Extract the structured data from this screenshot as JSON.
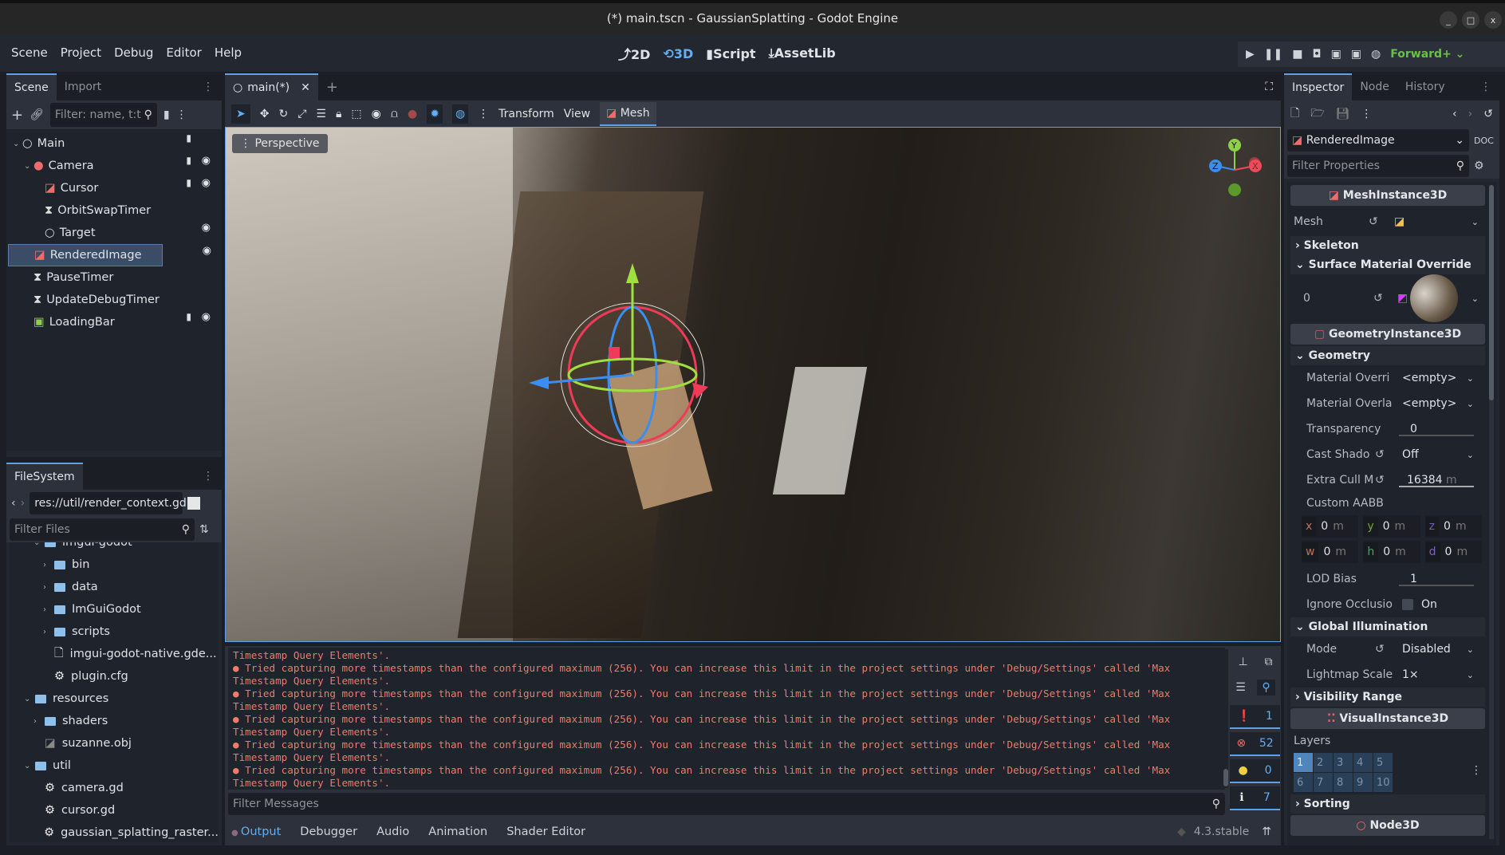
{
  "window": {
    "title": "(*) main.tscn - GaussianSplatting - Godot Engine",
    "min": "_",
    "max": "□",
    "close": "x"
  },
  "menu": [
    "Scene",
    "Project",
    "Debug",
    "Editor",
    "Help"
  ],
  "main_screens": [
    {
      "label": "2D",
      "icon": "⤴"
    },
    {
      "label": "3D",
      "icon": "⟲"
    },
    {
      "label": "Script",
      "icon": "▮"
    },
    {
      "label": "AssetLib",
      "icon": "⤓"
    }
  ],
  "run": {
    "renderer": "Forward+ ⌄"
  },
  "scene_dock": {
    "tabs": [
      "Scene",
      "Import"
    ],
    "filter_placeholder": "Filter: name, t:t",
    "tree": [
      {
        "label": "Main",
        "icon": "node3d-icon",
        "depth": 0,
        "script": true,
        "eye": false
      },
      {
        "label": "Camera",
        "icon": "camera-icon",
        "depth": 1,
        "script": true,
        "eye": true
      },
      {
        "label": "Cursor",
        "icon": "mesh-icon",
        "depth": 2,
        "script": true,
        "eye": true
      },
      {
        "label": "OrbitSwapTimer",
        "icon": "timer-icon",
        "depth": 2,
        "script": false,
        "eye": false
      },
      {
        "label": "Target",
        "icon": "node3d-icon",
        "depth": 2,
        "script": false,
        "eye": true
      },
      {
        "label": "RenderedImage",
        "icon": "mesh-icon",
        "depth": 1,
        "script": false,
        "eye": true,
        "selected": true
      },
      {
        "label": "PauseTimer",
        "icon": "timer-icon",
        "depth": 1,
        "script": false,
        "eye": false
      },
      {
        "label": "UpdateDebugTimer",
        "icon": "timer-icon",
        "depth": 1,
        "script": false,
        "eye": false
      },
      {
        "label": "LoadingBar",
        "icon": "texture-rect-icon",
        "depth": 1,
        "script": true,
        "eye": true
      }
    ]
  },
  "filesystem": {
    "tab": "FileSystem",
    "path": "res://util/render_context.gd",
    "filter_placeholder": "Filter Files",
    "items": [
      {
        "label": "imgui-godot",
        "type": "folder",
        "depth": 1,
        "open": true
      },
      {
        "label": "bin",
        "type": "folder",
        "depth": 2
      },
      {
        "label": "data",
        "type": "folder",
        "depth": 2
      },
      {
        "label": "ImGuiGodot",
        "type": "folder",
        "depth": 2
      },
      {
        "label": "scripts",
        "type": "folder",
        "depth": 2
      },
      {
        "label": "imgui-godot-native.gde...",
        "type": "file",
        "depth": 2
      },
      {
        "label": "plugin.cfg",
        "type": "cfg",
        "depth": 2
      },
      {
        "label": "resources",
        "type": "folder",
        "depth": 0,
        "open": true
      },
      {
        "label": "shaders",
        "type": "folder",
        "depth": 1
      },
      {
        "label": "suzanne.obj",
        "type": "mesh",
        "depth": 1
      },
      {
        "label": "util",
        "type": "folder",
        "depth": 0,
        "open": true
      },
      {
        "label": "camera.gd",
        "type": "script",
        "depth": 1
      },
      {
        "label": "cursor.gd",
        "type": "script",
        "depth": 1
      },
      {
        "label": "gaussian_splatting_raster...",
        "type": "script",
        "depth": 1
      }
    ]
  },
  "editor": {
    "scene_tab": "main(*)",
    "toolbar": {
      "transform": "Transform",
      "view": "View",
      "mesh": "Mesh"
    },
    "viewport_label": "Perspective",
    "gizmo_axes": [
      "X",
      "Y",
      "Z"
    ]
  },
  "output": {
    "lines": [
      {
        "text": "Timestamp Query Elements'.",
        "bullet": false
      },
      {
        "text": "Tried capturing more timestamps than the configured maximum (256). You can increase this limit in the project settings under 'Debug/Settings' called 'Max",
        "bullet": true
      },
      {
        "text": "Timestamp Query Elements'.",
        "bullet": false
      },
      {
        "text": "Tried capturing more timestamps than the configured maximum (256). You can increase this limit in the project settings under 'Debug/Settings' called 'Max",
        "bullet": true
      },
      {
        "text": "Timestamp Query Elements'.",
        "bullet": false
      },
      {
        "text": "Tried capturing more timestamps than the configured maximum (256). You can increase this limit in the project settings under 'Debug/Settings' called 'Max",
        "bullet": true
      },
      {
        "text": "Timestamp Query Elements'.",
        "bullet": false
      },
      {
        "text": "Tried capturing more timestamps than the configured maximum (256). You can increase this limit in the project settings under 'Debug/Settings' called 'Max",
        "bullet": true
      },
      {
        "text": "Timestamp Query Elements'.",
        "bullet": false
      },
      {
        "text": "Tried capturing more timestamps than the configured maximum (256). You can increase this limit in the project settings under 'Debug/Settings' called 'Max",
        "bullet": true
      },
      {
        "text": "Timestamp Query Elements'.",
        "bullet": false
      }
    ],
    "filter_placeholder": "Filter Messages",
    "counts": {
      "messages": "1",
      "errors": "52",
      "warnings": "0",
      "editor": "7"
    }
  },
  "bottom_tabs": [
    "Output",
    "Debugger",
    "Audio",
    "Animation",
    "Shader Editor"
  ],
  "version": "4.3.stable",
  "inspector": {
    "tabs": [
      "Inspector",
      "Node",
      "History"
    ],
    "node": "RenderedImage",
    "filter_placeholder": "Filter Properties",
    "mesh_instance": "MeshInstance3D",
    "mesh_label": "Mesh",
    "skeleton": "Skeleton",
    "surface_override": "Surface Material Override",
    "surface_index": "0",
    "geometry_instance": "GeometryInstance3D",
    "geometry": "Geometry",
    "material_override": {
      "label": "Material Overri",
      "value": "<empty>"
    },
    "material_overlay": {
      "label": "Material Overla",
      "value": "<empty>"
    },
    "transparency": {
      "label": "Transparency",
      "value": "0"
    },
    "cast_shadow": {
      "label": "Cast Shado",
      "value": "Off"
    },
    "extra_cull": {
      "label": "Extra Cull M",
      "value": "16384",
      "unit": "m"
    },
    "custom_aabb": {
      "label": "Custom AABB",
      "fields": [
        {
          "k": "x",
          "v": "0",
          "u": "m"
        },
        {
          "k": "y",
          "v": "0",
          "u": "m"
        },
        {
          "k": "z",
          "v": "0",
          "u": "m"
        },
        {
          "k": "w",
          "v": "0",
          "u": "m"
        },
        {
          "k": "h",
          "v": "0",
          "u": "m"
        },
        {
          "k": "d",
          "v": "0",
          "u": "m"
        }
      ]
    },
    "lod_bias": {
      "label": "LOD Bias",
      "value": "1"
    },
    "ignore_occlusion": {
      "label": "Ignore Occlusio",
      "value": "On",
      "checked": false
    },
    "gi": "Global Illumination",
    "gi_mode": {
      "label": "Mode",
      "value": "Disabled"
    },
    "lightmap_scale": {
      "label": "Lightmap Scale",
      "value": "1×"
    },
    "visibility_range": "Visibility Range",
    "visual_instance": "VisualInstance3D",
    "layers_label": "Layers",
    "layers": [
      "1",
      "2",
      "3",
      "4",
      "5",
      "6",
      "7",
      "8",
      "9",
      "10"
    ],
    "active_layer": "1",
    "sorting": "Sorting",
    "node3d": "Node3D"
  },
  "colors": {
    "accent": "#5da1e8",
    "error": "#f07a6e",
    "renderer": "#6cc04a"
  }
}
